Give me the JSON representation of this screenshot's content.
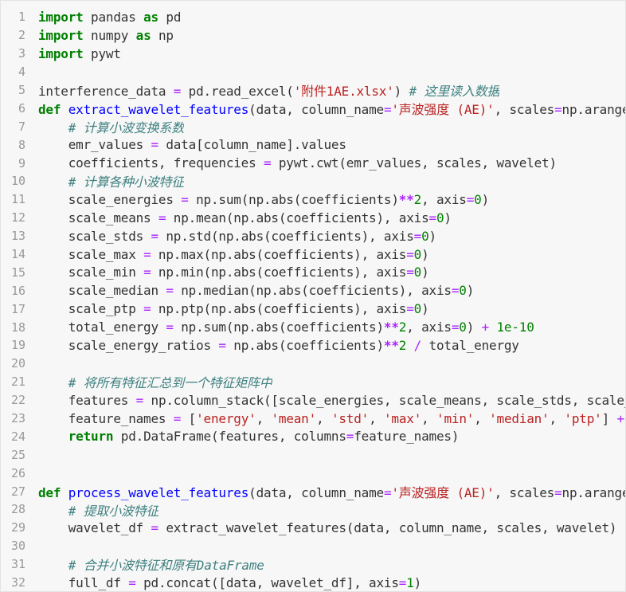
{
  "editor": {
    "lines": [
      {
        "n": "1",
        "tokens": [
          {
            "c": "kw",
            "t": "import"
          },
          {
            "c": "",
            "t": " pandas "
          },
          {
            "c": "kw",
            "t": "as"
          },
          {
            "c": "",
            "t": " pd"
          }
        ]
      },
      {
        "n": "2",
        "tokens": [
          {
            "c": "kw",
            "t": "import"
          },
          {
            "c": "",
            "t": " numpy "
          },
          {
            "c": "kw",
            "t": "as"
          },
          {
            "c": "",
            "t": " np"
          }
        ]
      },
      {
        "n": "3",
        "tokens": [
          {
            "c": "kw",
            "t": "import"
          },
          {
            "c": "",
            "t": " pywt"
          }
        ]
      },
      {
        "n": "4",
        "tokens": []
      },
      {
        "n": "5",
        "tokens": [
          {
            "c": "",
            "t": "interference_data "
          },
          {
            "c": "eq",
            "t": "="
          },
          {
            "c": "",
            "t": " pd.read_excel("
          },
          {
            "c": "st",
            "t": "'附件1AE.xlsx'"
          },
          {
            "c": "",
            "t": ") "
          },
          {
            "c": "cm",
            "t": "# 这里读入数据"
          }
        ]
      },
      {
        "n": "6",
        "tokens": [
          {
            "c": "kw",
            "t": "def"
          },
          {
            "c": "",
            "t": " "
          },
          {
            "c": "fn",
            "t": "extract_wavelet_features"
          },
          {
            "c": "",
            "t": "(data, column_name"
          },
          {
            "c": "eq",
            "t": "="
          },
          {
            "c": "st",
            "t": "'声波强度 (AE)'"
          },
          {
            "c": "",
            "t": ", scales"
          },
          {
            "c": "eq",
            "t": "="
          },
          {
            "c": "",
            "t": "np.arange"
          }
        ]
      },
      {
        "n": "7",
        "tokens": [
          {
            "c": "",
            "t": "    "
          },
          {
            "c": "cm",
            "t": "# 计算小波变换系数"
          }
        ]
      },
      {
        "n": "8",
        "tokens": [
          {
            "c": "",
            "t": "    emr_values "
          },
          {
            "c": "eq",
            "t": "="
          },
          {
            "c": "",
            "t": " data[column_name].values"
          }
        ]
      },
      {
        "n": "9",
        "tokens": [
          {
            "c": "",
            "t": "    coefficients, frequencies "
          },
          {
            "c": "eq",
            "t": "="
          },
          {
            "c": "",
            "t": " pywt.cwt(emr_values, scales, wavelet)"
          }
        ]
      },
      {
        "n": "10",
        "tokens": [
          {
            "c": "",
            "t": "    "
          },
          {
            "c": "cm",
            "t": "# 计算各种小波特征"
          }
        ]
      },
      {
        "n": "11",
        "tokens": [
          {
            "c": "",
            "t": "    scale_energies "
          },
          {
            "c": "eq",
            "t": "="
          },
          {
            "c": "",
            "t": " np.sum(np.abs(coefficients)"
          },
          {
            "c": "op",
            "t": "**"
          },
          {
            "c": "nm",
            "t": "2"
          },
          {
            "c": "",
            "t": ", axis"
          },
          {
            "c": "eq",
            "t": "="
          },
          {
            "c": "nm",
            "t": "0"
          },
          {
            "c": "",
            "t": ")"
          }
        ]
      },
      {
        "n": "12",
        "tokens": [
          {
            "c": "",
            "t": "    scale_means "
          },
          {
            "c": "eq",
            "t": "="
          },
          {
            "c": "",
            "t": " np.mean(np.abs(coefficients), axis"
          },
          {
            "c": "eq",
            "t": "="
          },
          {
            "c": "nm",
            "t": "0"
          },
          {
            "c": "",
            "t": ")"
          }
        ]
      },
      {
        "n": "13",
        "tokens": [
          {
            "c": "",
            "t": "    scale_stds "
          },
          {
            "c": "eq",
            "t": "="
          },
          {
            "c": "",
            "t": " np.std(np.abs(coefficients), axis"
          },
          {
            "c": "eq",
            "t": "="
          },
          {
            "c": "nm",
            "t": "0"
          },
          {
            "c": "",
            "t": ")"
          }
        ]
      },
      {
        "n": "14",
        "tokens": [
          {
            "c": "",
            "t": "    scale_max "
          },
          {
            "c": "eq",
            "t": "="
          },
          {
            "c": "",
            "t": " np.max(np.abs(coefficients), axis"
          },
          {
            "c": "eq",
            "t": "="
          },
          {
            "c": "nm",
            "t": "0"
          },
          {
            "c": "",
            "t": ")"
          }
        ]
      },
      {
        "n": "15",
        "tokens": [
          {
            "c": "",
            "t": "    scale_min "
          },
          {
            "c": "eq",
            "t": "="
          },
          {
            "c": "",
            "t": " np.min(np.abs(coefficients), axis"
          },
          {
            "c": "eq",
            "t": "="
          },
          {
            "c": "nm",
            "t": "0"
          },
          {
            "c": "",
            "t": ")"
          }
        ]
      },
      {
        "n": "16",
        "tokens": [
          {
            "c": "",
            "t": "    scale_median "
          },
          {
            "c": "eq",
            "t": "="
          },
          {
            "c": "",
            "t": " np.median(np.abs(coefficients), axis"
          },
          {
            "c": "eq",
            "t": "="
          },
          {
            "c": "nm",
            "t": "0"
          },
          {
            "c": "",
            "t": ")"
          }
        ]
      },
      {
        "n": "17",
        "tokens": [
          {
            "c": "",
            "t": "    scale_ptp "
          },
          {
            "c": "eq",
            "t": "="
          },
          {
            "c": "",
            "t": " np.ptp(np.abs(coefficients), axis"
          },
          {
            "c": "eq",
            "t": "="
          },
          {
            "c": "nm",
            "t": "0"
          },
          {
            "c": "",
            "t": ")"
          }
        ]
      },
      {
        "n": "18",
        "tokens": [
          {
            "c": "",
            "t": "    total_energy "
          },
          {
            "c": "eq",
            "t": "="
          },
          {
            "c": "",
            "t": " np.sum(np.abs(coefficients)"
          },
          {
            "c": "op",
            "t": "**"
          },
          {
            "c": "nm",
            "t": "2"
          },
          {
            "c": "",
            "t": ", axis"
          },
          {
            "c": "eq",
            "t": "="
          },
          {
            "c": "nm",
            "t": "0"
          },
          {
            "c": "",
            "t": ") "
          },
          {
            "c": "eq",
            "t": "+"
          },
          {
            "c": "",
            "t": " "
          },
          {
            "c": "nm",
            "t": "1e-10"
          }
        ]
      },
      {
        "n": "19",
        "tokens": [
          {
            "c": "",
            "t": "    scale_energy_ratios "
          },
          {
            "c": "eq",
            "t": "="
          },
          {
            "c": "",
            "t": " np.abs(coefficients)"
          },
          {
            "c": "op",
            "t": "**"
          },
          {
            "c": "nm",
            "t": "2"
          },
          {
            "c": "",
            "t": " "
          },
          {
            "c": "eq",
            "t": "/"
          },
          {
            "c": "",
            "t": " total_energy"
          }
        ]
      },
      {
        "n": "20",
        "tokens": []
      },
      {
        "n": "21",
        "tokens": [
          {
            "c": "",
            "t": "    "
          },
          {
            "c": "cm",
            "t": "# 将所有特征汇总到一个特征矩阵中"
          }
        ]
      },
      {
        "n": "22",
        "tokens": [
          {
            "c": "",
            "t": "    features "
          },
          {
            "c": "eq",
            "t": "="
          },
          {
            "c": "",
            "t": " np.column_stack([scale_energies, scale_means, scale_stds, scale_"
          }
        ]
      },
      {
        "n": "23",
        "tokens": [
          {
            "c": "",
            "t": "    feature_names "
          },
          {
            "c": "eq",
            "t": "="
          },
          {
            "c": "",
            "t": " ["
          },
          {
            "c": "st",
            "t": "'energy'"
          },
          {
            "c": "",
            "t": ", "
          },
          {
            "c": "st",
            "t": "'mean'"
          },
          {
            "c": "",
            "t": ", "
          },
          {
            "c": "st",
            "t": "'std'"
          },
          {
            "c": "",
            "t": ", "
          },
          {
            "c": "st",
            "t": "'max'"
          },
          {
            "c": "",
            "t": ", "
          },
          {
            "c": "st",
            "t": "'min'"
          },
          {
            "c": "",
            "t": ", "
          },
          {
            "c": "st",
            "t": "'median'"
          },
          {
            "c": "",
            "t": ", "
          },
          {
            "c": "st",
            "t": "'ptp'"
          },
          {
            "c": "",
            "t": "] "
          },
          {
            "c": "eq",
            "t": "+"
          }
        ]
      },
      {
        "n": "24",
        "tokens": [
          {
            "c": "",
            "t": "    "
          },
          {
            "c": "kw",
            "t": "return"
          },
          {
            "c": "",
            "t": " pd.DataFrame(features, columns"
          },
          {
            "c": "eq",
            "t": "="
          },
          {
            "c": "",
            "t": "feature_names)"
          }
        ]
      },
      {
        "n": "25",
        "tokens": []
      },
      {
        "n": "26",
        "tokens": []
      },
      {
        "n": "27",
        "tokens": [
          {
            "c": "kw",
            "t": "def"
          },
          {
            "c": "",
            "t": " "
          },
          {
            "c": "fn",
            "t": "process_wavelet_features"
          },
          {
            "c": "",
            "t": "(data, column_name"
          },
          {
            "c": "eq",
            "t": "="
          },
          {
            "c": "st",
            "t": "'声波强度 (AE)'"
          },
          {
            "c": "",
            "t": ", scales"
          },
          {
            "c": "eq",
            "t": "="
          },
          {
            "c": "",
            "t": "np.arange"
          }
        ]
      },
      {
        "n": "28",
        "tokens": [
          {
            "c": "",
            "t": "    "
          },
          {
            "c": "cm",
            "t": "# 提取小波特征"
          }
        ]
      },
      {
        "n": "29",
        "tokens": [
          {
            "c": "",
            "t": "    wavelet_df "
          },
          {
            "c": "eq",
            "t": "="
          },
          {
            "c": "",
            "t": " extract_wavelet_features(data, column_name, scales, wavelet)"
          }
        ]
      },
      {
        "n": "30",
        "tokens": []
      },
      {
        "n": "31",
        "tokens": [
          {
            "c": "",
            "t": "    "
          },
          {
            "c": "cm",
            "t": "# 合并小波特征和原有DataFrame"
          }
        ]
      },
      {
        "n": "32",
        "tokens": [
          {
            "c": "",
            "t": "    full_df "
          },
          {
            "c": "eq",
            "t": "="
          },
          {
            "c": "",
            "t": " pd.concat([data, wavelet_df], axis"
          },
          {
            "c": "eq",
            "t": "="
          },
          {
            "c": "nm",
            "t": "1"
          },
          {
            "c": "",
            "t": ")"
          }
        ]
      }
    ]
  }
}
